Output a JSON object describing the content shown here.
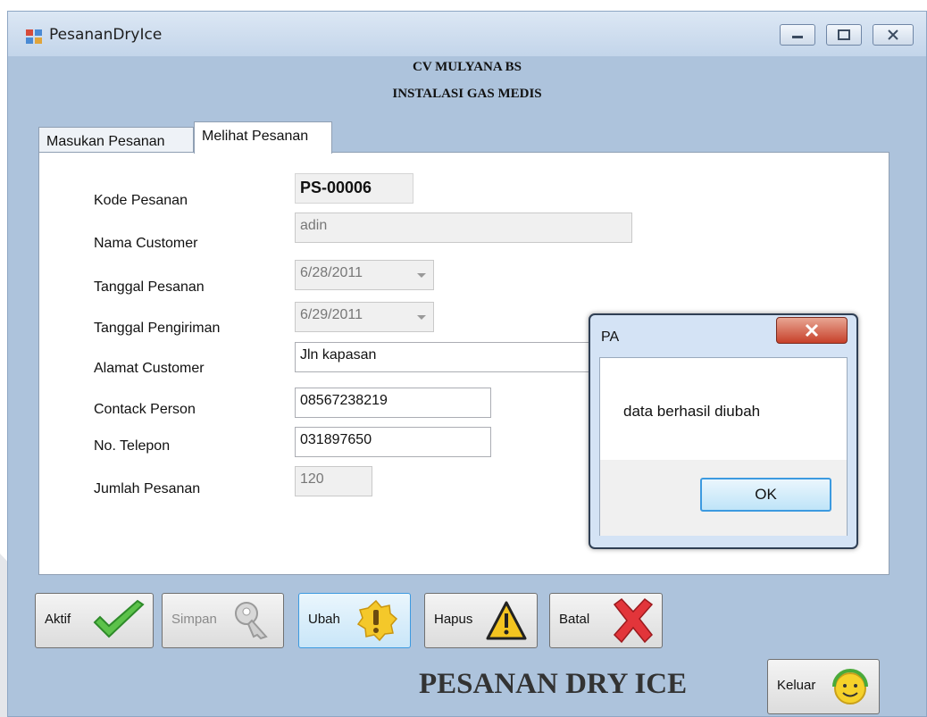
{
  "window": {
    "title": "PesananDryIce"
  },
  "header": {
    "line1": "CV MULYANA BS",
    "line2": "INSTALASI GAS MEDIS"
  },
  "tabs": [
    {
      "label": "Masukan Pesanan"
    },
    {
      "label": "Melihat Pesanan"
    }
  ],
  "form": {
    "kode_label": "Kode Pesanan",
    "kode_value": "PS-00006",
    "nama_label": "Nama Customer",
    "nama_value": "adin",
    "tgl_pesan_label": "Tanggal Pesanan",
    "tgl_pesan_value": "6/28/2011",
    "tgl_kirim_label": "Tanggal Pengiriman",
    "tgl_kirim_value": "6/29/2011",
    "alamat_label": "Alamat Customer",
    "alamat_value": "Jln kapasan",
    "contact_label": "Contack Person",
    "contact_value": "08567238219",
    "telp_label": "No. Telepon",
    "telp_value": "031897650",
    "jumlah_label": "Jumlah Pesanan",
    "jumlah_value": "120"
  },
  "buttons": {
    "aktif": "Aktif",
    "simpan": "Simpan",
    "ubah": "Ubah",
    "hapus": "Hapus",
    "batal": "Batal",
    "keluar": "Keluar"
  },
  "footer": {
    "title": "PESANAN DRY ICE"
  },
  "dialog": {
    "title": "PA",
    "message": "data berhasil diubah",
    "ok": "OK"
  },
  "icons": {
    "aktif": "check-icon",
    "simpan": "key-icon",
    "ubah": "exclamation-badge-icon",
    "hapus": "warning-triangle-icon",
    "batal": "red-x-icon",
    "keluar": "smiley-headset-icon"
  },
  "colors": {
    "window_bg": "#adc3dc",
    "accent_blue": "#3c9ae0",
    "close_red": "#c7402a"
  }
}
